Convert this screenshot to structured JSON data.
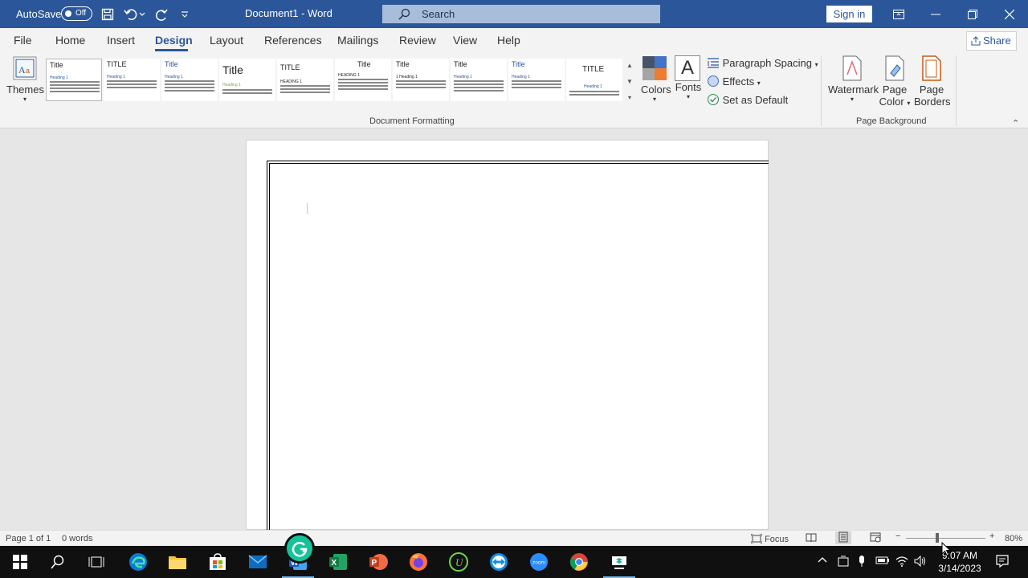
{
  "titlebar": {
    "autosave_label": "AutoSave",
    "autosave_state": "Off",
    "doc_title": "Document1 - Word",
    "search_placeholder": "Search",
    "signin_label": "Sign in"
  },
  "menu": {
    "tabs": [
      "File",
      "Home",
      "Insert",
      "Design",
      "Layout",
      "References",
      "Mailings",
      "Review",
      "View",
      "Help"
    ],
    "active": "Design",
    "share_label": "Share"
  },
  "ribbon": {
    "themes_label": "Themes",
    "gallery": [
      {
        "title": "Title",
        "heading": "Heading 1"
      },
      {
        "title": "TITLE",
        "heading": "Heading 1"
      },
      {
        "title": "Title",
        "heading": "Heading 1"
      },
      {
        "title": "Title",
        "heading": "Heading 1"
      },
      {
        "title": "TITLE",
        "heading": "HEADING 1"
      },
      {
        "title": "Title",
        "heading": "HEADING 1"
      },
      {
        "title": "Title",
        "heading": "1 Heading 1"
      },
      {
        "title": "Title",
        "heading": "Heading 1"
      },
      {
        "title": "Title",
        "heading": "Heading 1"
      },
      {
        "title": "TITLE",
        "heading": "Heading 1"
      }
    ],
    "colors_label": "Colors",
    "fonts_label": "Fonts",
    "fonts_glyph": "A",
    "paragraph_spacing_label": "Paragraph Spacing",
    "effects_label": "Effects",
    "set_default_label": "Set as Default",
    "doc_formatting_label": "Document Formatting",
    "watermark_label": "Watermark",
    "page_color_label_1": "Page",
    "page_color_label_2": "Color",
    "page_borders_label_1": "Page",
    "page_borders_label_2": "Borders",
    "page_background_label": "Page Background"
  },
  "status": {
    "page": "Page 1 of 1",
    "words": "0 words",
    "focus": "Focus",
    "zoom": "80%"
  },
  "taskbar": {
    "apps": [
      "start-icon",
      "search-icon",
      "task-view-icon",
      "edge-icon",
      "file-explorer-icon",
      "store-icon",
      "mail-icon",
      "word-icon",
      "excel-icon",
      "powerpoint-icon",
      "firefox-icon",
      "upwork-icon",
      "teamviewer-icon",
      "zoom-icon",
      "chrome-icon",
      "recorder-icon"
    ],
    "zoom_app_text": "zoom",
    "time": "9:07 AM",
    "date": "3/14/2023"
  },
  "colors": {
    "accent": "#2b579a",
    "taskbar": "#101010"
  }
}
